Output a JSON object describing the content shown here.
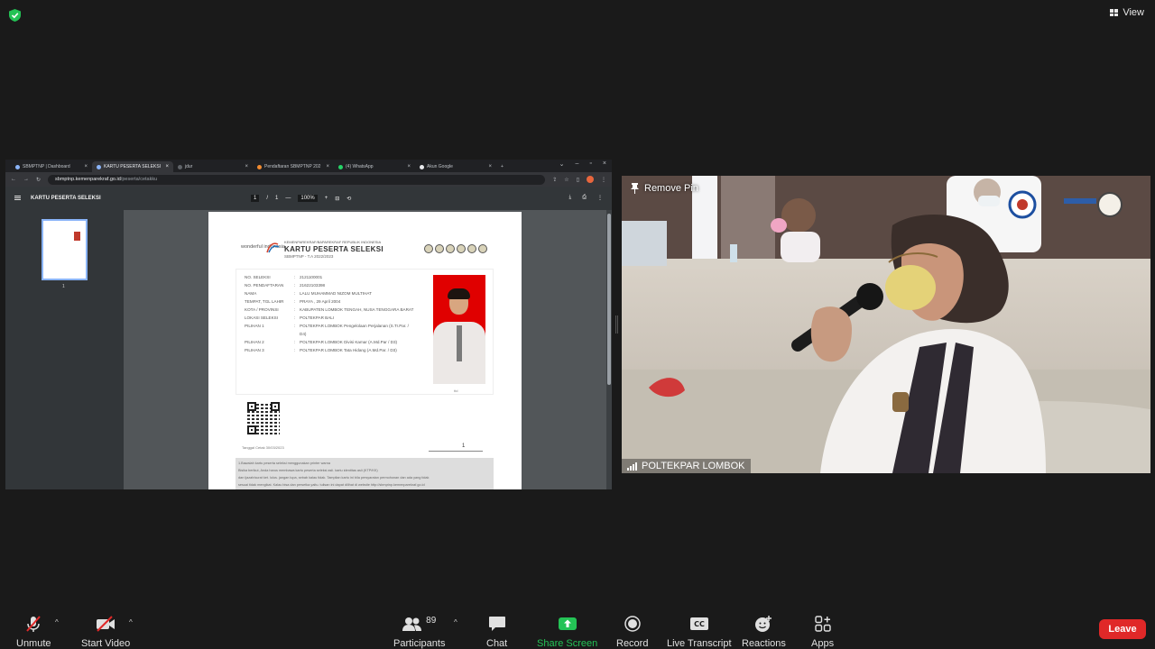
{
  "top_bar": {
    "view_label": "View"
  },
  "browser": {
    "tabs": [
      {
        "label": "SBMPTNP | Dashboard"
      },
      {
        "label": "KARTU PESERTA SELEKSI"
      },
      {
        "label": "jdur"
      },
      {
        "label": "Pendaftaran SBMPTNP 202"
      },
      {
        "label": "(4) WhatsApp"
      },
      {
        "label": "Akun Google"
      }
    ],
    "new_tab": "+",
    "url_host": "sbmptnp.kemenparekraf.go.id",
    "url_path": "/peserta/cetakku"
  },
  "pdf": {
    "title": "KARTU PESERTA SELEKSI",
    "page_current": "1",
    "page_sep": "/",
    "page_total": "1",
    "zoom": "100%",
    "thumb_number": "1"
  },
  "card": {
    "logo_text": "wonderful indonesia",
    "ministry": "KEMENPAREKRAF/BAPAREKRAF REPUBLIK INDONESIA",
    "title": "KARTU PESERTA SELEKSI",
    "year": "SBMPTNP - T.A 2022/2023",
    "fields": [
      {
        "key": "NO. SELEKSI",
        "value": "2121100001"
      },
      {
        "key": "NO. PENDAFTARAN",
        "value": "21622103398"
      },
      {
        "key": "NAMA",
        "value": "LALU MUHAMMAD NIZOM MULTIHAT"
      },
      {
        "key": "TEMPAT, TGL LAHIR",
        "value": "PRAYA , 29 April 2004"
      },
      {
        "key": "KOTA / PROVINSI",
        "value": "KABUPATEN LOMBOK TENGAH, NUSA TENGGARA BARAT"
      },
      {
        "key": "LOKASI SELEKSI",
        "value": "POLTEKPAR BALI"
      },
      {
        "key": "PILIHAN 1",
        "value": "POLTEKPAR LOMBOK Pengelolaan Perjalanan (S.Tr.Par. /"
      },
      {
        "key": "",
        "value": "D4)"
      },
      {
        "key": "PILIHAN 2",
        "value": "POLTEKPAR LOMBOK Divisi Kamar (A.Md.Par / D3)"
      },
      {
        "key": "PILIHAN 3",
        "value": "POLTEKPAR LOMBOK Tata Hidang (A.Md.Par. / D3)"
      }
    ],
    "photo_caption": "ttd",
    "print_date": "Tanggal Cetak 30/03/2023",
    "signature_mark": "1",
    "notes": [
      "1.Bawalah kartu peserta seleksi menggunakan printer warna",
      "Bisika berikut, Anda harus membawa kartu peserta seleksi asli. kartu identitas asli (KTP/KK)",
      "dan ijazah/surat ket. lulus. jangan lupa, sebab kalau tidak. Tampilan kartu ini bila persyaratan permohonan dan ada yang tidak",
      "sesuai tidak mengikat. Kalau bisa dan persetka yaitu. tulisan ini dapat dilihat di website http://sbmptnp.kemenparekraf.go.id"
    ]
  },
  "video": {
    "remove_pin_label": "Remove Pin",
    "participant_name": "POLTEKPAR LOMBOK"
  },
  "controls": {
    "unmute": "Unmute",
    "start_video": "Start Video",
    "participants": "Participants",
    "participants_count": "89",
    "chat": "Chat",
    "share_screen": "Share Screen",
    "record": "Record",
    "live_transcript": "Live Transcript",
    "reactions": "Reactions",
    "apps": "Apps",
    "leave": "Leave"
  },
  "colors": {
    "share_green": "#24c356",
    "leave_red": "#e02828",
    "background": "#1a1a1a"
  }
}
